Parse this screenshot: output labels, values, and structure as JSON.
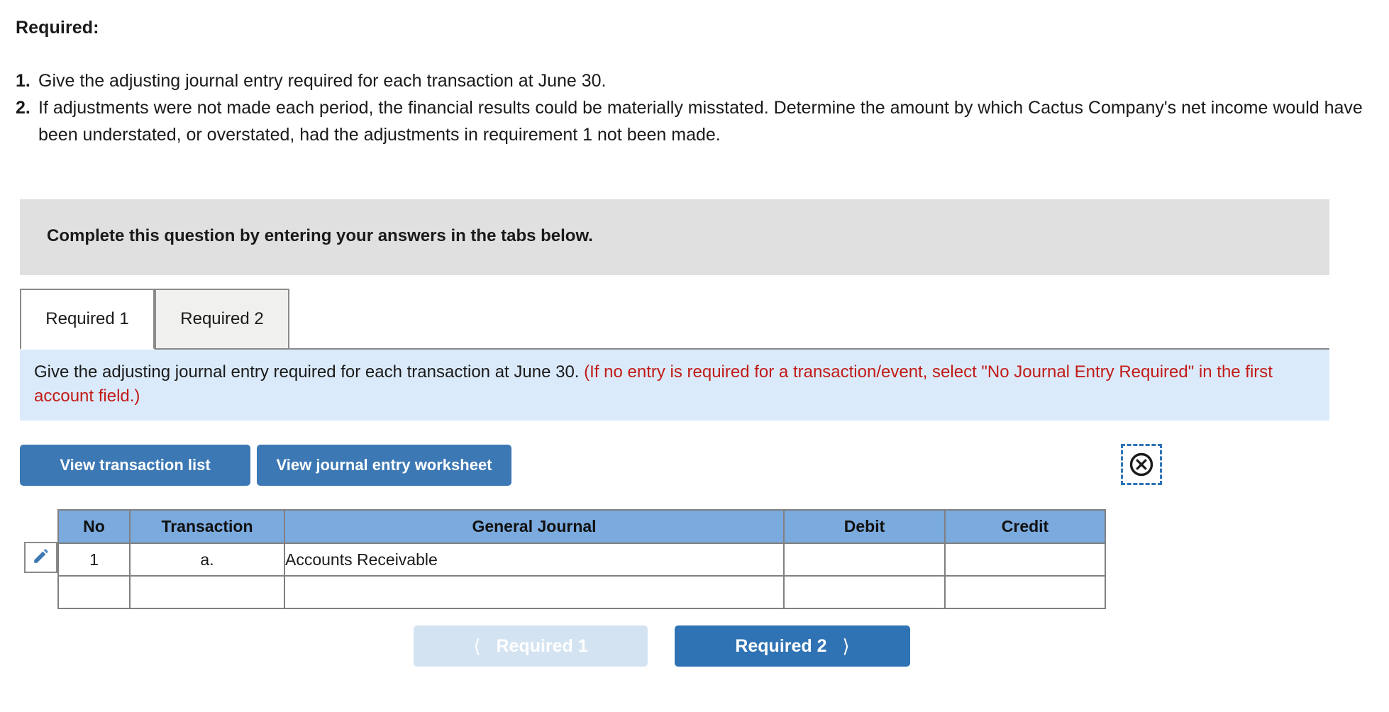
{
  "question": {
    "required_heading": "Required:",
    "items": [
      {
        "num": "1.",
        "text": "Give the adjusting journal entry required for each transaction at June 30."
      },
      {
        "num": "2.",
        "text": "If adjustments were not made each period, the financial results could be materially misstated. Determine the amount by which Cactus Company's net income would have been understated, or overstated, had the adjustments in requirement 1 not been made."
      }
    ]
  },
  "banner": {
    "text": "Complete this question by entering your answers in the tabs below."
  },
  "tabs": [
    {
      "label": "Required 1",
      "active": true
    },
    {
      "label": "Required 2",
      "active": false
    }
  ],
  "info": {
    "prompt": "Give the adjusting journal entry required for each transaction at June 30.",
    "hint": "(If no entry is required for a transaction/event, select \"No Journal Entry Required\" in the first account field.)"
  },
  "toolbar": {
    "transaction_list_label": "View transaction list",
    "journal_worksheet_label": "View journal entry worksheet",
    "close_icon": "circle-x-icon",
    "edit_icon": "pencil-icon"
  },
  "journal_table": {
    "columns": [
      "No",
      "Transaction",
      "General Journal",
      "Debit",
      "Credit"
    ],
    "rows": [
      {
        "no": "1",
        "transaction": "a.",
        "general_journal": "Accounts Receivable",
        "debit": "",
        "credit": ""
      },
      {
        "no": "",
        "transaction": "",
        "general_journal": "",
        "debit": "",
        "credit": ""
      }
    ]
  },
  "nav": {
    "prev_label": "Required 1",
    "prev_chevron": "chevron-left-icon",
    "next_label": "Required 2",
    "next_chevron": "chevron-right-icon"
  },
  "colors": {
    "primary_blue": "#3c78b4",
    "table_header_blue": "#7aaade",
    "info_panel_blue": "#daeafa",
    "banner_grey": "#e0e0e0",
    "hint_red": "#c21b17",
    "disabled_blue": "#d4e3f1"
  }
}
